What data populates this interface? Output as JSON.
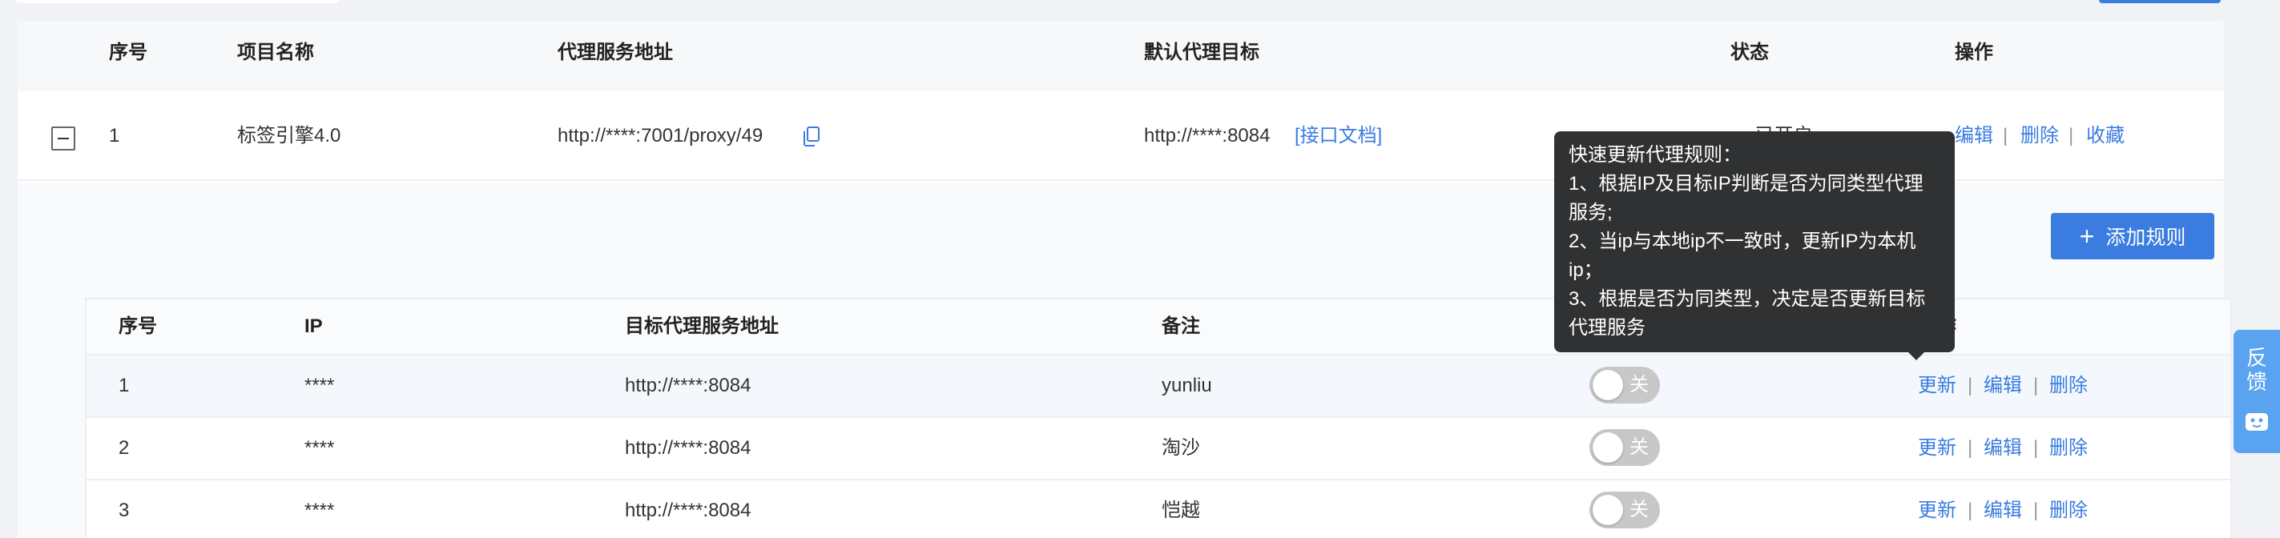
{
  "outer_table": {
    "headers": {
      "index": "序号",
      "name": "项目名称",
      "proxy_address": "代理服务地址",
      "default_target": "默认代理目标",
      "status": "状态",
      "actions": "操作"
    },
    "row": {
      "index": "1",
      "name": "标签引擎4.0",
      "proxy_address": "http://****:7001/proxy/49",
      "default_target": "http://****:8084",
      "doc_link": "[接口文档]",
      "status": "已开启",
      "actions": {
        "edit": "编辑",
        "delete": "删除",
        "favorite": "收藏",
        "separator": "|"
      }
    }
  },
  "add_rule_button": {
    "label": "添加规则",
    "icon": "plus-icon"
  },
  "inner_table": {
    "headers": {
      "index": "序号",
      "ip": "IP",
      "target_address": "目标代理服务地址",
      "remark": "备注",
      "actions": "操作"
    },
    "rows": [
      {
        "index": "1",
        "ip": "****",
        "target": "http://****:8084",
        "remark": "yunliu",
        "toggle": "关",
        "update": "更新",
        "edit": "编辑",
        "delete": "删除",
        "sep": "|"
      },
      {
        "index": "2",
        "ip": "****",
        "target": "http://****:8084",
        "remark": "淘沙",
        "toggle": "关",
        "update": "更新",
        "edit": "编辑",
        "delete": "删除",
        "sep": "|"
      },
      {
        "index": "3",
        "ip": "****",
        "target": "http://****:8084",
        "remark": "恺越",
        "toggle": "关",
        "update": "更新",
        "edit": "编辑",
        "delete": "删除",
        "sep": "|"
      }
    ]
  },
  "tooltip": {
    "title": "快速更新代理规则：",
    "lines": [
      "1、根据IP及目标IP判断是否为同类型代理服务;",
      "2、当ip与本地ip不一致时，更新IP为本机ip；",
      "3、根据是否为同类型，决定是否更新目标代理服务"
    ]
  },
  "feedback": {
    "label_1": "反",
    "label_2": "馈",
    "icon": "robot-face-icon"
  },
  "colors": {
    "accent": "#3a7ce0",
    "tooltip_bg": "#303133",
    "toggle_off": "#c8c8c8",
    "status_dot": "#2e8b57",
    "feedback_bg": "#5aa3f0"
  }
}
